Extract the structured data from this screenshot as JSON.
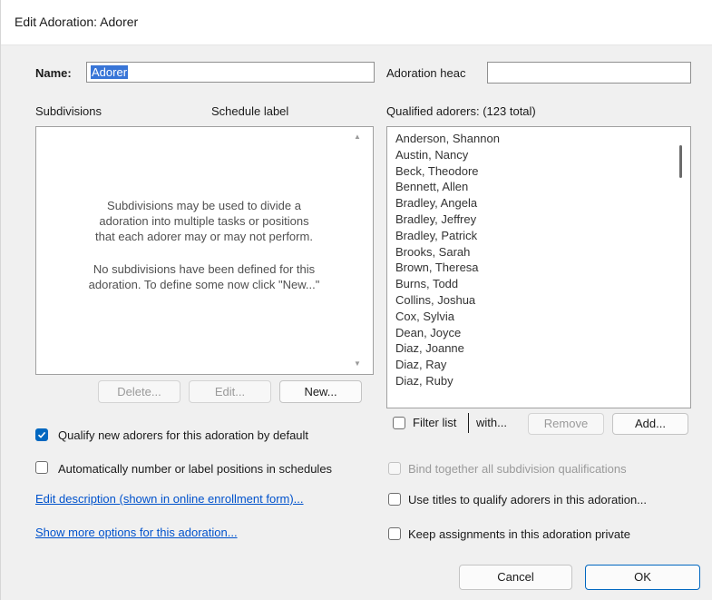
{
  "window": {
    "title": "Edit Adoration: Adorer"
  },
  "name_field": {
    "label": "Name:",
    "value": "Adorer"
  },
  "adoration_head": {
    "label": "Adoration heac",
    "value": ""
  },
  "subdivisions": {
    "header_label": "Subdivisions",
    "schedule_label": "Schedule label",
    "empty_message_1": "Subdivisions may be used to divide a",
    "empty_message_2": "adoration into multiple tasks or positions",
    "empty_message_3": "that each adorer may or may not perform.",
    "empty_message_4": "No subdivisions have been defined for this",
    "empty_message_5": "adoration. To define some now click \"New...\"",
    "delete_label": "Delete...",
    "edit_label": "Edit...",
    "new_label": "New..."
  },
  "qualified": {
    "header": "Qualified adorers:  (123 total)",
    "items": [
      "Anderson, Shannon",
      "Austin, Nancy",
      "Beck, Theodore",
      "Bennett, Allen",
      "Bradley, Angela",
      "Bradley, Jeffrey",
      "Bradley, Patrick",
      "Brooks, Sarah",
      "Brown, Theresa",
      "Burns, Todd",
      "Collins, Joshua",
      "Cox, Sylvia",
      "Dean, Joyce",
      "Diaz, Joanne",
      "Diaz, Ray",
      "Diaz, Ruby"
    ],
    "filter_label": "Filter list",
    "with_label": "with...",
    "remove_label": "Remove",
    "add_label": "Add..."
  },
  "options": {
    "qualify_new": {
      "label": "Qualify new adorers for this adoration by default",
      "checked": true
    },
    "auto_number": {
      "label": "Automatically number or label positions in schedules",
      "checked": false
    },
    "bind_together": {
      "label": "Bind together all subdivision qualifications",
      "checked": false
    },
    "use_titles": {
      "label": "Use titles to qualify adorers in this adoration...",
      "checked": false
    },
    "keep_private": {
      "label": "Keep assignments in this adoration private",
      "checked": false
    }
  },
  "links": {
    "edit_description": "Edit description (shown in online enrollment form)...",
    "more_options": "Show more options for this adoration..."
  },
  "footer": {
    "cancel_label": "Cancel",
    "ok_label": "OK"
  },
  "colors": {
    "accent": "#0067c0",
    "selection": "#3875d7",
    "link": "#0052cc",
    "background": "#f0f0f0"
  }
}
